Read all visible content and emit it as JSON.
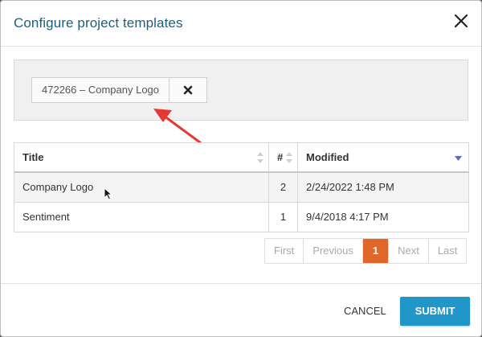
{
  "dialog": {
    "title": "Configure project templates",
    "close_icon": "close-icon"
  },
  "filter": {
    "selected_tag": "472266 – Company Logo",
    "remove_icon": "remove-x-icon"
  },
  "table": {
    "columns": [
      "Title",
      "#",
      "Modified"
    ],
    "sort_column": "Modified",
    "sort_direction": "descending",
    "rows": [
      {
        "title": "Company Logo",
        "count": "2",
        "modified": "2/24/2022 1:48 PM"
      },
      {
        "title": "Sentiment",
        "count": "1",
        "modified": "9/4/2018 4:17 PM"
      }
    ]
  },
  "pagination": {
    "first": "First",
    "previous": "Previous",
    "current": "1",
    "next": "Next",
    "last": "Last"
  },
  "footer": {
    "cancel_label": "CANCEL",
    "submit_label": "SUBMIT"
  },
  "colors": {
    "title": "#1b5f7f",
    "active_page": "#e0662a",
    "submit": "#2196c9",
    "annotation_arrow": "#e53935",
    "sort_indicator": "#5c6bc0"
  }
}
